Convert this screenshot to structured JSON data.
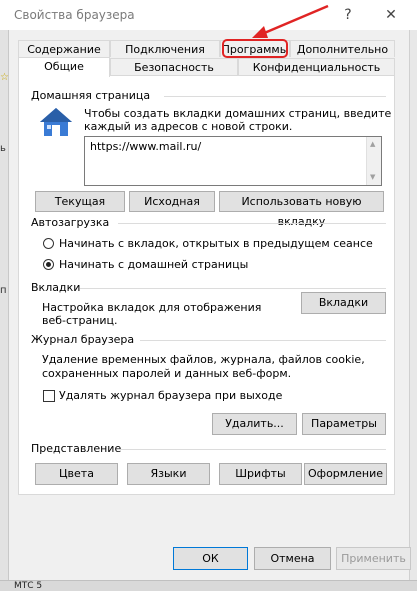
{
  "window": {
    "title": "Свойства браузера",
    "help_glyph": "?",
    "close_glyph": "✕"
  },
  "tabs_row_back": [
    "Содержание",
    "Подключения",
    "Программы",
    "Дополнительно"
  ],
  "tabs_row_front": [
    "Общие",
    "Безопасность",
    "Конфиденциальность"
  ],
  "annotation": {
    "highlight_color": "#e02424",
    "highlighted_tab": "Программы"
  },
  "home": {
    "section_title": "Домашняя страница",
    "description_line1": "Чтобы создать вкладки домашних страниц, введите",
    "description_line2": "каждый из адресов с новой строки.",
    "url_value": "https://www.mail.ru/",
    "current_button": "Текущая",
    "original_button": "Исходная",
    "new_tab_button": "Использовать новую вкладку"
  },
  "startup": {
    "section_title": "Автозагрузка",
    "option1": "Начинать с вкладок, открытых в предыдущем сеансе",
    "option2": "Начинать с домашней страницы",
    "selected": "option2"
  },
  "tabs_section": {
    "section_title": "Вкладки",
    "description_line1": "Настройка вкладок для отображения",
    "description_line2": "веб-страниц.",
    "button": "Вкладки"
  },
  "history": {
    "section_title": "Журнал браузера",
    "description_line1": "Удаление временных файлов, журнала, файлов cookie,",
    "description_line2": "сохраненных паролей и данных веб-форм.",
    "checkbox_label": "Удалять журнал браузера при выходе",
    "checkbox_checked": false,
    "delete_button": "Удалить...",
    "params_button": "Параметры"
  },
  "appearance": {
    "section_title": "Представление",
    "colors_button": "Цвета",
    "languages_button": "Языки",
    "fonts_button": "Шрифты",
    "design_button": "Оформление"
  },
  "footer": {
    "ok_button": "ОК",
    "cancel_button": "Отмена",
    "apply_button": "Применить"
  },
  "background_fragments": {
    "left_marks": [
      "☆",
      "ь",
      "п"
    ],
    "bottom_left_text": "МТС 5"
  }
}
